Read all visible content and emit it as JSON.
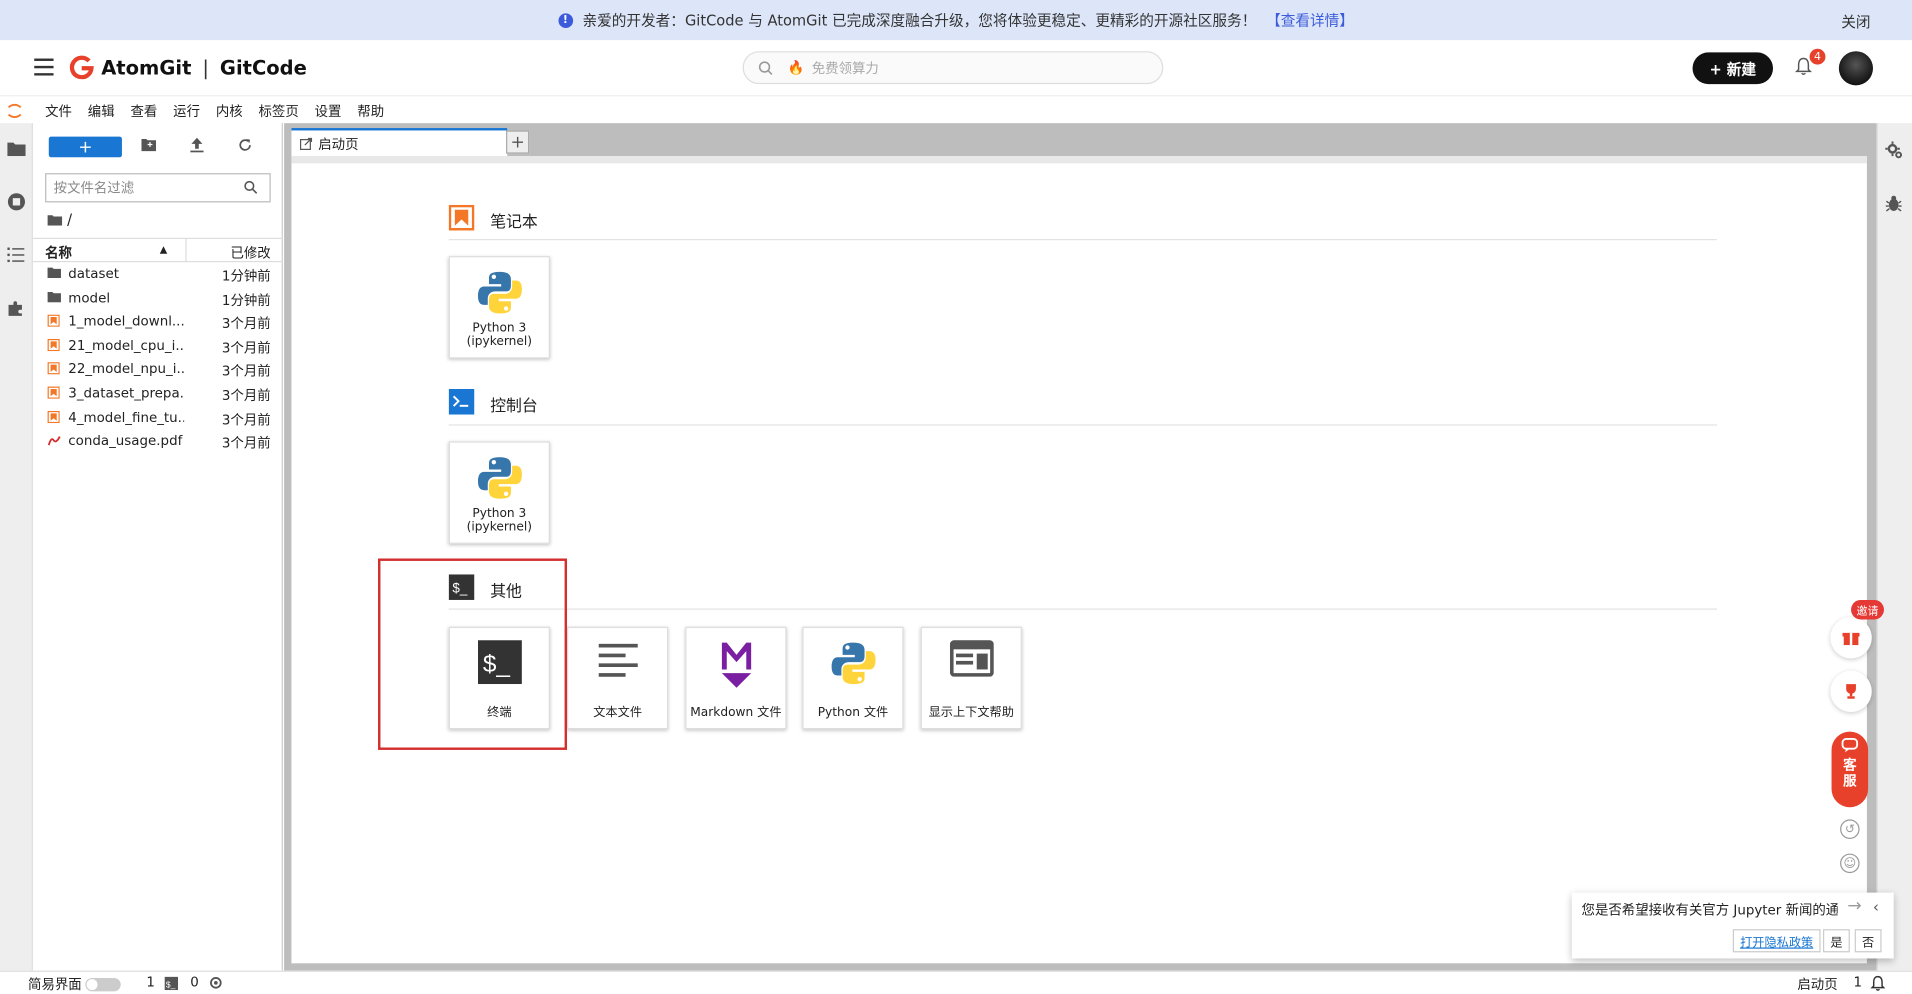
{
  "banner": {
    "message": "亲爱的开发者：GitCode 与 AtomGit 已完成深度融合升级，您将体验更稳定、更精彩的开源社区服务！",
    "link": "【查看详情】",
    "close": "关闭",
    "info_icon": "!"
  },
  "header": {
    "brand_a": "AtomGit",
    "sep": "|",
    "brand_b": "GitCode",
    "search_placeholder": "免费领算力",
    "new_button": "+ 新建",
    "notification_count": "4"
  },
  "menubar": [
    "文件",
    "编辑",
    "查看",
    "运行",
    "内核",
    "标签页",
    "设置",
    "帮助"
  ],
  "filebrowser": {
    "new_label": "+",
    "filter_placeholder": "按文件名过滤",
    "path": "/",
    "col_name": "名称",
    "col_modified": "已修改",
    "items": [
      {
        "name": "dataset",
        "modified": "1分钟前",
        "type": "folder"
      },
      {
        "name": "model",
        "modified": "1分钟前",
        "type": "folder"
      },
      {
        "name": "1_model_downl...",
        "modified": "3个月前",
        "type": "notebook"
      },
      {
        "name": "21_model_cpu_i...",
        "modified": "3个月前",
        "type": "notebook"
      },
      {
        "name": "22_model_npu_i...",
        "modified": "3个月前",
        "type": "notebook"
      },
      {
        "name": "3_dataset_prepa...",
        "modified": "3个月前",
        "type": "notebook"
      },
      {
        "name": "4_model_fine_tu...",
        "modified": "3个月前",
        "type": "notebook"
      },
      {
        "name": "conda_usage.pdf",
        "modified": "3个月前",
        "type": "pdf"
      }
    ]
  },
  "tab": {
    "label": "启动页",
    "add": "+"
  },
  "launcher": {
    "notebook": {
      "title": "笔记本",
      "cards": [
        {
          "l1": "Python 3",
          "l2": "(ipykernel)"
        }
      ]
    },
    "console": {
      "title": "控制台",
      "cards": [
        {
          "l1": "Python 3",
          "l2": "(ipykernel)"
        }
      ]
    },
    "other": {
      "title": "其他",
      "cards": [
        "终端",
        "文本文件",
        "Markdown 文件",
        "Python 文件",
        "显示上下文帮助"
      ]
    }
  },
  "float": {
    "invite": "邀请",
    "kefu_1": "客",
    "kefu_2": "服"
  },
  "notification": {
    "message": "您是否希望接收有关官方 Jupyter 新闻的通知？",
    "policy": "打开隐私政策",
    "yes": "是",
    "no": "否"
  },
  "status": {
    "simple": "简易界面",
    "kernels": "1",
    "terminals": "0",
    "right_label": "启动页",
    "right_count": "1"
  },
  "colors": {
    "accent": "#1976d2",
    "brand_red": "#e8412b",
    "highlight": "#d32f2f"
  }
}
